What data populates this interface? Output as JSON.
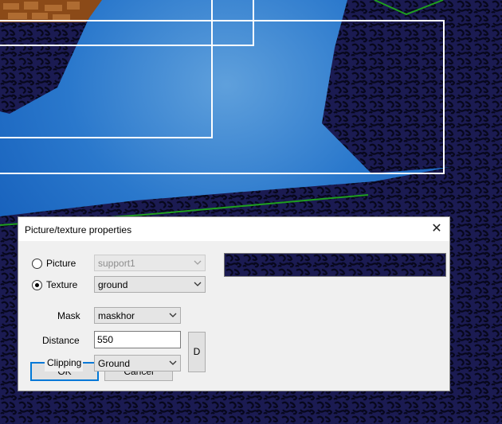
{
  "dialog": {
    "title": "Picture/texture properties",
    "close_glyph": "✕",
    "picture_label": "Picture",
    "picture_value": "support1",
    "texture_label": "Texture",
    "texture_value": "ground",
    "selected_option": "Texture",
    "mask_label": "Mask",
    "mask_value": "maskhor",
    "distance_label": "Distance",
    "distance_value": "550",
    "d_button_label": "D",
    "clipping_label": "Clipping",
    "clipping_value": "Ground",
    "ok_label": "OK",
    "cancel_label": "Cancel"
  },
  "colors": {
    "sky": "#1665c2",
    "sky_light": "#4f93d6",
    "texture_dark": "#1b1b52",
    "texture_pattern": "#0a0a20",
    "ground_line": "#1f9e1f",
    "selection_outline": "#ffffff",
    "default_button_border": "#0078d7"
  },
  "icons": {
    "close": "close-icon",
    "dropdown": "chevron-down-icon"
  }
}
